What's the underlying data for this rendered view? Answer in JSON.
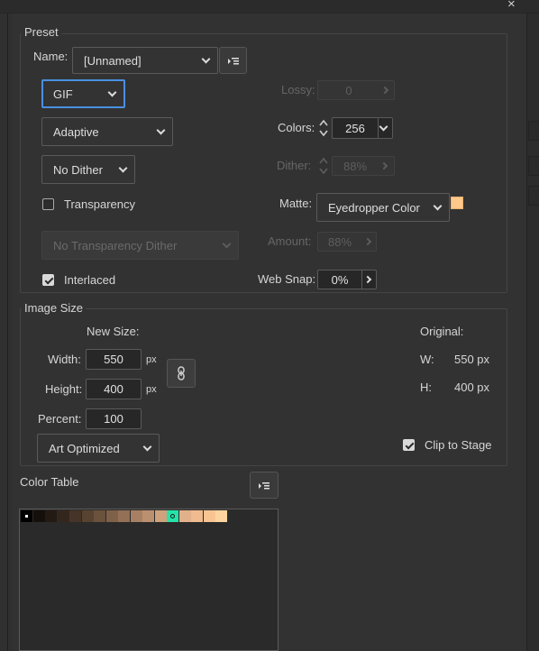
{
  "window": {
    "close_glyph": "×"
  },
  "preset": {
    "group_title": "Preset",
    "name_label": "Name:",
    "name_value": "[Unnamed]",
    "menu_icon": "panel-menu-icon",
    "format_value": "GIF",
    "palette_value": "Adaptive",
    "dither_mode_value": "No Dither",
    "transparency_label": "Transparency",
    "transparency_checked": false,
    "transparency_dither_value": "No Transparency Dither",
    "interlaced_label": "Interlaced",
    "interlaced_checked": true,
    "lossy_label": "Lossy:",
    "lossy_value": "0",
    "colors_label": "Colors:",
    "colors_value": "256",
    "dither_label": "Dither:",
    "dither_value": "88%",
    "matte_label": "Matte:",
    "matte_value": "Eyedropper Color",
    "matte_color": "#fdc889",
    "amount_label": "Amount:",
    "amount_value": "88%",
    "websnap_label": "Web Snap:",
    "websnap_value": "0%"
  },
  "image_size": {
    "group_title": "Image Size",
    "new_size_label": "New Size:",
    "width_label": "Width:",
    "width_value": "550",
    "height_label": "Height:",
    "height_value": "400",
    "px_unit": "px",
    "percent_label": "Percent:",
    "percent_value": "100",
    "quality_value": "Art Optimized",
    "link_icon": "constrain-proportions-icon",
    "original_label": "Original:",
    "orig_w_label": "W:",
    "orig_w_value": "550 px",
    "orig_h_label": "H:",
    "orig_h_value": "400 px",
    "clip_label": "Clip to Stage",
    "clip_checked": true
  },
  "color_table": {
    "title": "Color Table",
    "menu_icon": "panel-menu-icon",
    "swatches": [
      "#000000",
      "#140f0b",
      "#231a13",
      "#33261c",
      "#453427",
      "#584331",
      "#6b523d",
      "#7f6149",
      "#937056",
      "#a78063",
      "#bb9070",
      "#cfa17d",
      "#27e2a8",
      "#e2b08a",
      "#f1bb90",
      "#f8c592",
      "#fdd4a0"
    ]
  }
}
